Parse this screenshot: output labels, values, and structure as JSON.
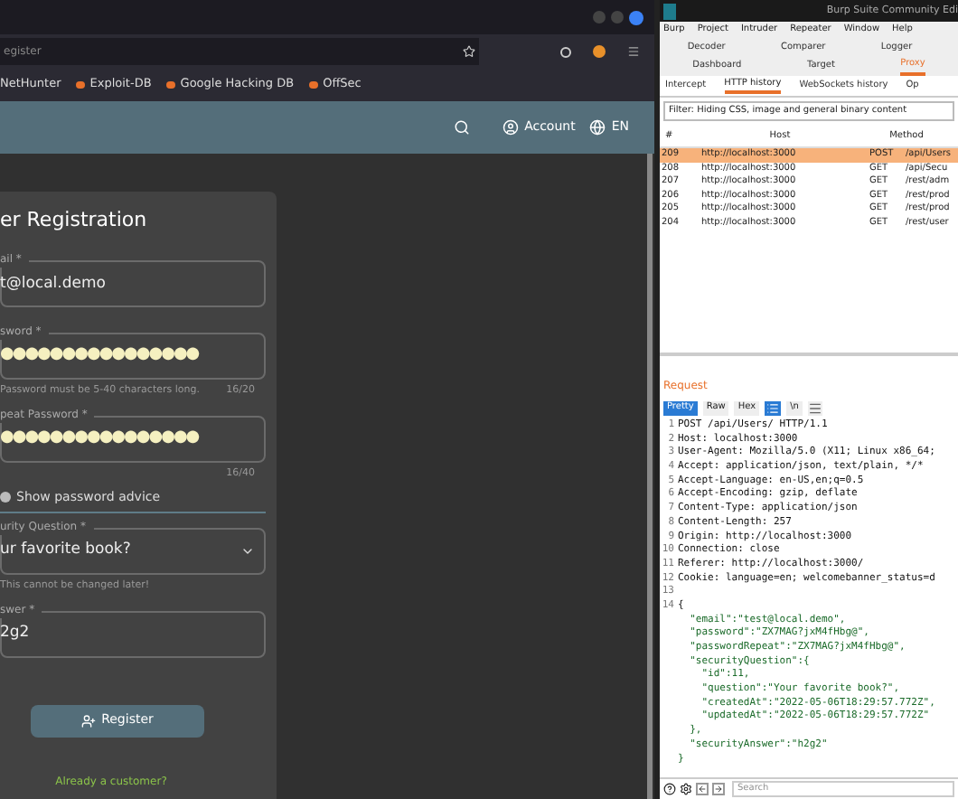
{
  "browser": {
    "url": "egister",
    "bookmarks": [
      {
        "label": "NetHunter"
      },
      {
        "label": "Exploit-DB"
      },
      {
        "label": "Google Hacking DB"
      },
      {
        "label": "OffSec"
      }
    ]
  },
  "app_bar": {
    "account": "Account",
    "language": "EN"
  },
  "form": {
    "title": "er Registration",
    "email": {
      "label": "ail *",
      "value": "t@local.demo"
    },
    "password": {
      "label": "sword *",
      "value": "●●●●●●●●●●●●●●●●",
      "hint": "Password must be 5-40 characters long.",
      "counter": "16/20"
    },
    "repeat_password": {
      "label": "peat Password *",
      "value": "●●●●●●●●●●●●●●●●",
      "counter": "16/40"
    },
    "advice_toggle": {
      "label": "Show password advice",
      "on": false
    },
    "security_question": {
      "label": "urity Question *",
      "value": "ur favorite book?",
      "hint": "This cannot be changed later!"
    },
    "answer": {
      "label": "swer *",
      "value": "2g2"
    },
    "register_button": "Register",
    "login_link": "Already a customer?"
  },
  "burp": {
    "title": "Burp Suite Community Edi",
    "menu": [
      "Burp",
      "Project",
      "Intruder",
      "Repeater",
      "Window",
      "Help"
    ],
    "tabs_row_1": [
      {
        "label": "Decoder",
        "selected": false
      },
      {
        "label": "Comparer",
        "selected": false
      },
      {
        "label": "Logger",
        "selected": false
      }
    ],
    "tabs_row_2": [
      {
        "label": "Dashboard",
        "selected": false
      },
      {
        "label": "Target",
        "selected": false
      },
      {
        "label": "Proxy",
        "selected": true
      }
    ],
    "proxy_tabs": [
      {
        "label": "Intercept",
        "selected": false
      },
      {
        "label": "HTTP history",
        "selected": true
      },
      {
        "label": "WebSockets history",
        "selected": false
      },
      {
        "label": "Op",
        "selected": false
      }
    ],
    "filter": "Filter: Hiding CSS, image and general binary content",
    "table": {
      "columns": [
        "#",
        "Host",
        "Method"
      ],
      "rows": [
        {
          "id": "209",
          "host": "http://localhost:3000",
          "method": "POST",
          "column_4": "/api/Users",
          "selected": true
        },
        {
          "id": "208",
          "host": "http://localhost:3000",
          "method": "GET",
          "column_4": "/api/Secu",
          "selected": false
        },
        {
          "id": "207",
          "host": "http://localhost:3000",
          "method": "GET",
          "column_4": "/rest/adm",
          "selected": false
        },
        {
          "id": "206",
          "host": "http://localhost:3000",
          "method": "GET",
          "column_4": "/rest/prod",
          "selected": false
        },
        {
          "id": "205",
          "host": "http://localhost:3000",
          "method": "GET",
          "column_4": "/rest/prod",
          "selected": false
        },
        {
          "id": "204",
          "host": "http://localhost:3000",
          "method": "GET",
          "column_4": "/rest/user",
          "selected": false
        }
      ]
    },
    "request": {
      "title": "Request",
      "view_tabs": [
        {
          "label": "Pretty",
          "selected": true
        },
        {
          "label": "Raw",
          "selected": false
        },
        {
          "label": "Hex",
          "selected": false
        },
        {
          "label": "\\n",
          "selected": false
        }
      ],
      "lines": [
        {
          "num": "1",
          "kind": "header",
          "text": "POST /api/Users/ HTTP/1.1"
        },
        {
          "num": "2",
          "kind": "header",
          "text": "Host: localhost:3000"
        },
        {
          "num": "3",
          "kind": "header",
          "text": "User-Agent: Mozilla/5.0 (X11; Linux x86_64;"
        },
        {
          "num": "4",
          "kind": "header",
          "text": "Accept: application/json, text/plain, */*"
        },
        {
          "num": "5",
          "kind": "header",
          "text": "Accept-Language: en-US,en;q=0.5"
        },
        {
          "num": "6",
          "kind": "header",
          "text": "Accept-Encoding: gzip, deflate"
        },
        {
          "num": "7",
          "kind": "header",
          "text": "Content-Type: application/json"
        },
        {
          "num": "8",
          "kind": "header",
          "text": "Content-Length: 257"
        },
        {
          "num": "9",
          "kind": "header",
          "text": "Origin: http://localhost:3000"
        },
        {
          "num": "10",
          "kind": "header",
          "text": "Connection: close"
        },
        {
          "num": "11",
          "kind": "header",
          "text": "Referer: http://localhost:3000/"
        },
        {
          "num": "12",
          "kind": "header",
          "text": "Cookie: language=en; welcomebanner_status=d"
        },
        {
          "num": "13",
          "kind": "blank"
        },
        {
          "num": "14",
          "kind": "header",
          "text": "{"
        },
        {
          "kind": "json",
          "text": "  \"email\":\"test@local.demo\","
        },
        {
          "kind": "json",
          "text": "  \"password\":\"ZX7MAG?jxM4fHbg@\","
        },
        {
          "kind": "json",
          "text": "  \"passwordRepeat\":\"ZX7MAG?jxM4fHbg@\","
        },
        {
          "kind": "json",
          "text": "  \"securityQuestion\":{"
        },
        {
          "kind": "json",
          "text": "    \"id\":11,"
        },
        {
          "kind": "json",
          "text": "    \"question\":\"Your favorite book?\","
        },
        {
          "kind": "json",
          "text": "    \"createdAt\":\"2022-05-06T18:29:57.772Z\","
        },
        {
          "kind": "json",
          "text": "    \"updatedAt\":\"2022-05-06T18:29:57.772Z\""
        },
        {
          "kind": "json",
          "text": "  },"
        },
        {
          "kind": "json",
          "text": "  \"securityAnswer\":\"h2g2\""
        },
        {
          "kind": "json",
          "text": "}"
        }
      ]
    },
    "search_placeholder": "Search"
  }
}
